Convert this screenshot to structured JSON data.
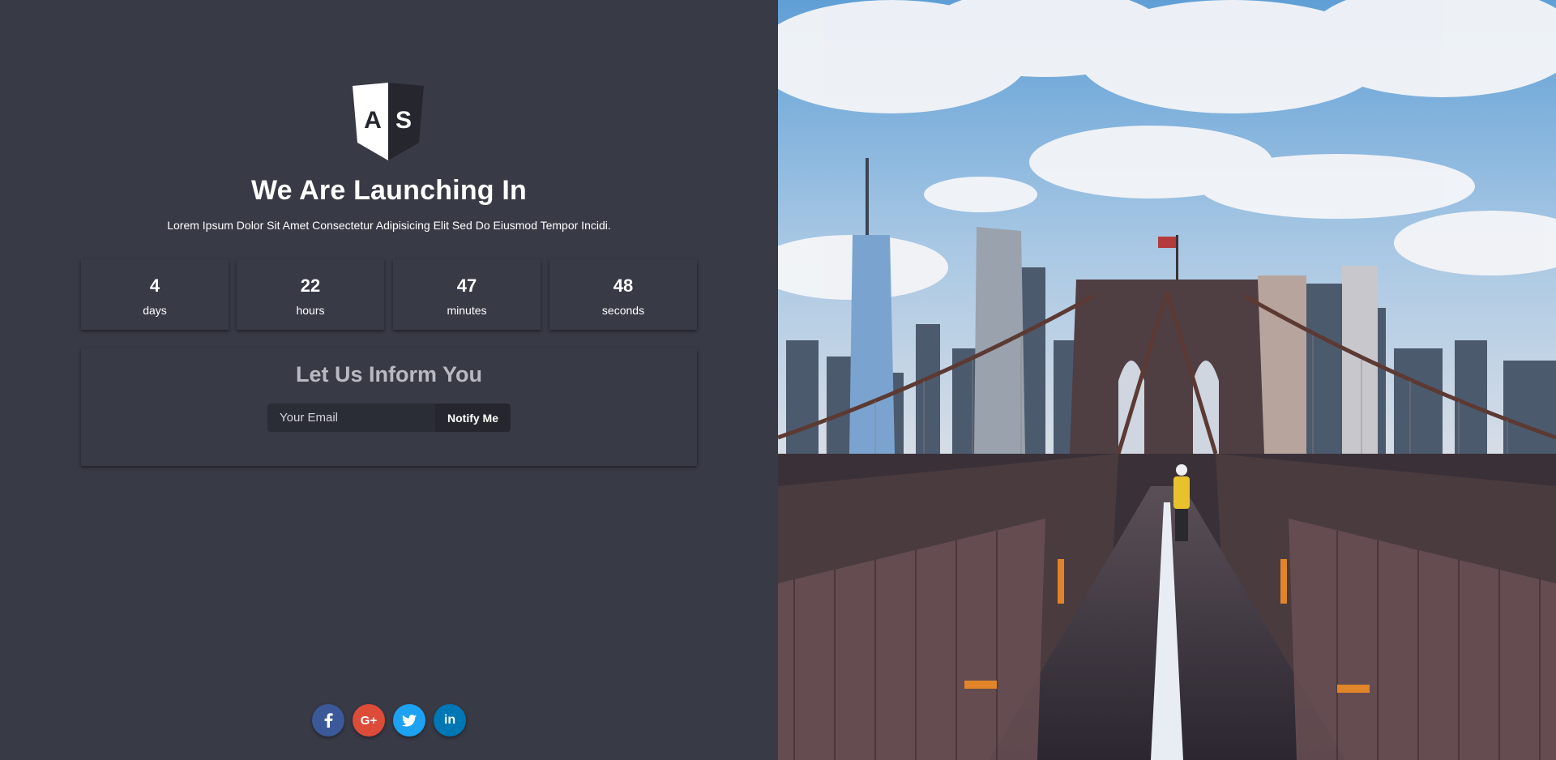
{
  "logo": {
    "letters": [
      "A",
      "S"
    ]
  },
  "hero": {
    "title": "We Are Launching In",
    "subtitle": "Lorem Ipsum Dolor Sit Amet Consectetur Adipisicing Elit Sed Do Eiusmod Tempor Incidi."
  },
  "countdown": [
    {
      "value": "4",
      "label": "days"
    },
    {
      "value": "22",
      "label": "hours"
    },
    {
      "value": "47",
      "label": "minutes"
    },
    {
      "value": "48",
      "label": "seconds"
    }
  ],
  "inform": {
    "title": "Let Us Inform You",
    "email_placeholder": "Your Email",
    "email_value": "",
    "button_label": "Notify Me"
  },
  "social": [
    {
      "name": "facebook",
      "icon": "facebook-icon",
      "color": "#3b5998"
    },
    {
      "name": "google-plus",
      "icon": "google-plus-icon",
      "color": "#dd4b39",
      "text": "G+"
    },
    {
      "name": "twitter",
      "icon": "twitter-icon",
      "color": "#1da1f2"
    },
    {
      "name": "linkedin",
      "icon": "linkedin-icon",
      "color": "#0077b5",
      "text": "in"
    }
  ],
  "colors": {
    "panel_bg": "#383a46",
    "input_bg": "#2b2d36",
    "button_bg": "#25262e",
    "inform_title": "#b9bac1"
  }
}
